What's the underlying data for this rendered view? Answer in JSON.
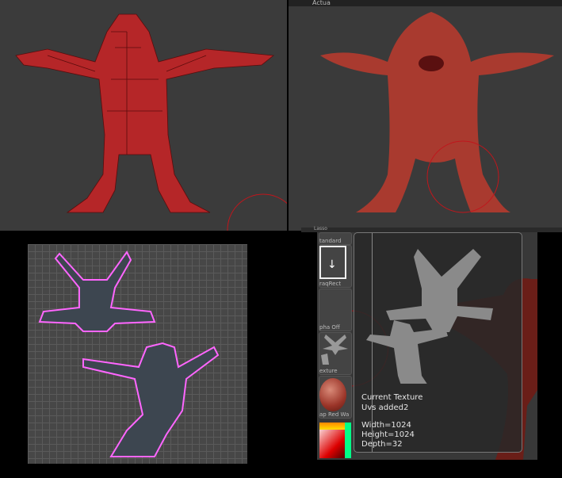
{
  "viewports": {
    "top_left": {
      "shading": "polyframe-lowres",
      "model_color": "#b8282a"
    },
    "top_right": {
      "shading": "smooth",
      "model_color": "#a83a2e",
      "top_label": "Actua"
    },
    "bottom_left": {
      "view": "uv-map",
      "seam_color": "#ff66ff"
    }
  },
  "tray": {
    "items": [
      {
        "label": "tandard"
      },
      {
        "label": "raqRect"
      },
      {
        "label": "pha Off"
      },
      {
        "label": "exture"
      },
      {
        "label": "ap Red Wa"
      }
    ],
    "lasso_label": "Lasso"
  },
  "texture_popup": {
    "title": "Current Texture",
    "name": "Uvs added2",
    "width": "Width=1024",
    "height": "Height=1024",
    "depth": "Depth=32"
  },
  "colors": {
    "brush_circle": "#c0161c",
    "uv_island": "#8a8a8a"
  }
}
